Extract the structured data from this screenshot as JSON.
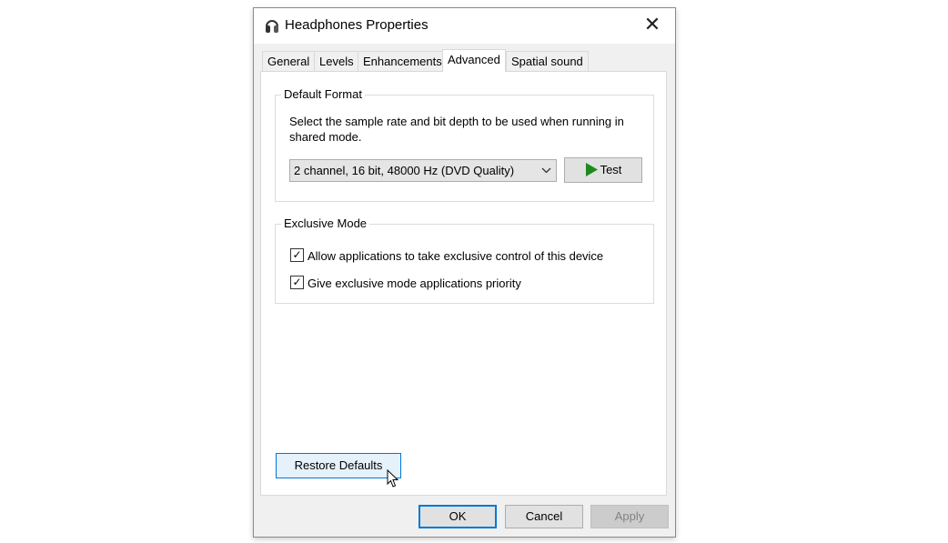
{
  "window": {
    "title": "Headphones Properties",
    "icon": "headphones-icon"
  },
  "tabs": [
    {
      "label": "General"
    },
    {
      "label": "Levels"
    },
    {
      "label": "Enhancements"
    },
    {
      "label": "Advanced",
      "active": true
    },
    {
      "label": "Spatial sound"
    }
  ],
  "default_format": {
    "title": "Default Format",
    "description": "Select the sample rate and bit depth to be used when running in shared mode.",
    "selected": "2 channel, 16 bit, 48000 Hz (DVD Quality)",
    "test_label": "Test"
  },
  "exclusive_mode": {
    "title": "Exclusive Mode",
    "options": [
      {
        "label": "Allow applications to take exclusive control of this device",
        "checked": true
      },
      {
        "label": "Give exclusive mode applications priority",
        "checked": true
      }
    ]
  },
  "buttons": {
    "restore": "Restore Defaults",
    "ok": "OK",
    "cancel": "Cancel",
    "apply": "Apply"
  },
  "colors": {
    "accent": "#0078d7",
    "play": "#1e8a1e"
  }
}
